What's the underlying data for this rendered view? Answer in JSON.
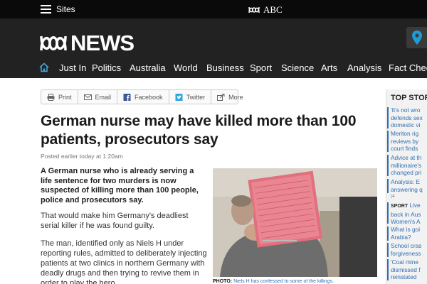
{
  "topbar": {
    "sites_label": "Sites",
    "brand": "ABC"
  },
  "header": {
    "logo_text": "NEWS"
  },
  "nav": {
    "items": [
      {
        "label": "Just In"
      },
      {
        "label": "Politics"
      },
      {
        "label": "Australia"
      },
      {
        "label": "World"
      },
      {
        "label": "Business"
      },
      {
        "label": "Sport"
      },
      {
        "label": "Science"
      },
      {
        "label": "Arts"
      },
      {
        "label": "Analysis"
      },
      {
        "label": "Fact Check"
      }
    ]
  },
  "share": {
    "print": "Print",
    "email": "Email",
    "facebook": "Facebook",
    "twitter": "Twitter",
    "more": "More"
  },
  "article": {
    "headline": "German nurse may have killed more than 100 patients, prosecutors say",
    "posted": "Posted earlier today at 1:20am",
    "lead": "A German nurse who is already serving a life sentence for two murders is now suspected of killing more than 100 people, police and prosecutors say.",
    "para1": "That would make him Germany's deadliest serial killer if he was found guilty.",
    "para2": "The man, identified only as Niels H under reporting rules, admitted to deliberately injecting patients at two clinics in northern Germany with deadly drugs and then trying to revive them in order to play the hero.",
    "caption_label": "PHOTO:",
    "caption_text": "Niels H has confessed to some of the killings."
  },
  "sidebar": {
    "title": "TOP STORIES",
    "stories": [
      {
        "line1": "'It's not wro",
        "line2": "defends sex",
        "line3": "domestic vi"
      },
      {
        "line1": "Meriton rig",
        "line2": "reviews by",
        "line3": "court finds"
      },
      {
        "line1": "Advice at th",
        "line2": "millionaire's",
        "line3": "changed pri"
      },
      {
        "line1": "Analysis: E",
        "line2": "answering q"
      },
      {
        "tag": "SPORT",
        "line1": "Live",
        "line2": "back in Aus",
        "line3": "Women's A"
      },
      {
        "line1": "What is goi",
        "line2": "Arabia?"
      },
      {
        "line1": "School cras",
        "line2": "forgiveness"
      },
      {
        "line1": "'Coal mine",
        "line2": "dismissed f",
        "line3": "reinstated"
      }
    ],
    "count_label": "(4"
  },
  "colors": {
    "topbar_bg": "#0a0a0a",
    "header_bg": "#222222",
    "link_blue": "#2f6fb2",
    "location_pin": "#1e9bd7"
  }
}
